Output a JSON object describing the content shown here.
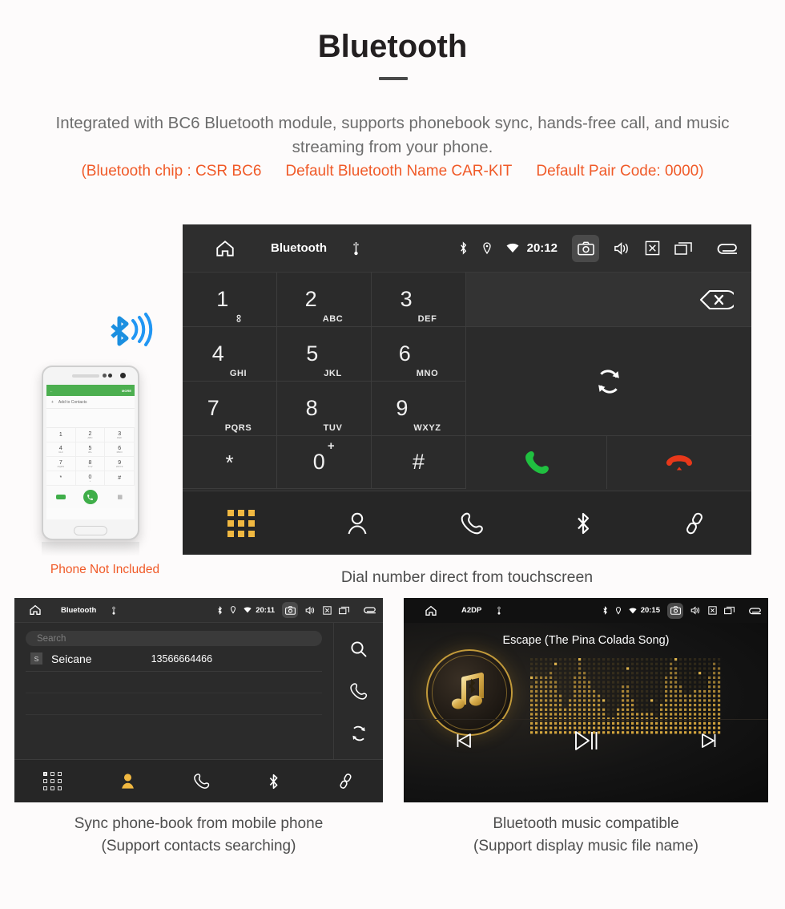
{
  "header": {
    "title": "Bluetooth",
    "subtitle": "Integrated with BC6 Bluetooth module, supports phonebook sync, hands-free call, and music streaming from your phone.",
    "spec_open": "(Bluetooth chip : CSR BC6",
    "spec_name": "Default Bluetooth Name CAR-KIT",
    "spec_code": "Default Pair Code: 0000)",
    "accent_color": "#f05a28",
    "title_color": "#231f20",
    "subtitle_color": "#6d6d6d"
  },
  "phone_photo": {
    "caption": "Phone Not Included",
    "bar_more": "MORE",
    "add_to_contacts": "Add to Contacts",
    "keys": [
      {
        "digit": "1",
        "letters": ""
      },
      {
        "digit": "2",
        "letters": "ABC"
      },
      {
        "digit": "3",
        "letters": "DEF"
      },
      {
        "digit": "4",
        "letters": "GHI"
      },
      {
        "digit": "5",
        "letters": "JKL"
      },
      {
        "digit": "6",
        "letters": "MNO"
      },
      {
        "digit": "7",
        "letters": "PQRS"
      },
      {
        "digit": "8",
        "letters": "TUV"
      },
      {
        "digit": "9",
        "letters": "WXYZ"
      },
      {
        "digit": "*",
        "letters": ""
      },
      {
        "digit": "0",
        "letters": "+"
      },
      {
        "digit": "#",
        "letters": ""
      }
    ]
  },
  "dialer_screen": {
    "status": {
      "title": "Bluetooth",
      "clock": "20:12",
      "icons": [
        "home-icon",
        "usb-icon",
        "bluetooth-icon",
        "location-icon",
        "wifi-icon",
        "camera-icon",
        "volume-icon",
        "close-icon",
        "recents-icon",
        "back-icon"
      ]
    },
    "keys": [
      {
        "digit": "1",
        "letters": "∞",
        "name": "key-1"
      },
      {
        "digit": "2",
        "letters": "ABC",
        "name": "key-2"
      },
      {
        "digit": "3",
        "letters": "DEF",
        "name": "key-3"
      },
      {
        "digit": "4",
        "letters": "GHI",
        "name": "key-4"
      },
      {
        "digit": "5",
        "letters": "JKL",
        "name": "key-5"
      },
      {
        "digit": "6",
        "letters": "MNO",
        "name": "key-6"
      },
      {
        "digit": "7",
        "letters": "PQRS",
        "name": "key-7"
      },
      {
        "digit": "8",
        "letters": "TUV",
        "name": "key-8"
      },
      {
        "digit": "9",
        "letters": "WXYZ",
        "name": "key-9"
      },
      {
        "digit": "*",
        "letters": "",
        "name": "key-star"
      },
      {
        "digit": "0",
        "letters": "+",
        "name": "key-0"
      },
      {
        "digit": "#",
        "letters": "",
        "name": "key-hash"
      }
    ],
    "number_field_value": "",
    "call_color": "#20c040",
    "hangup_color": "#e8381a",
    "tabs": [
      "keypad-tab",
      "contacts-tab",
      "call-log-tab",
      "bluetooth-tab",
      "pair-tab"
    ],
    "active_tab": "keypad-tab",
    "active_tab_color": "#f0b841",
    "caption": "Dial number direct from touchscreen"
  },
  "phonebook_screen": {
    "status": {
      "title": "Bluetooth",
      "clock": "20:11"
    },
    "search_placeholder": "Search",
    "contacts": [
      {
        "initial": "S",
        "name": "Seicane",
        "number": "13566664466"
      }
    ],
    "side_actions": [
      "search-icon",
      "call-icon",
      "sync-icon"
    ],
    "tabs": [
      "keypad-tab",
      "contacts-tab",
      "call-log-tab",
      "bluetooth-tab",
      "pair-tab"
    ],
    "active_tab": "contacts-tab",
    "caption_line1": "Sync phone-book from mobile phone",
    "caption_line2": "(Support contacts searching)"
  },
  "music_screen": {
    "status": {
      "title": "A2DP",
      "clock": "20:15"
    },
    "track_name": "Escape (The Pina Colada Song)",
    "controls": [
      "previous-button",
      "play-pause-button",
      "next-button"
    ],
    "accent_color": "#c29a3a",
    "caption_line1": "Bluetooth music compatible",
    "caption_line2": "(Support display music file name)"
  }
}
